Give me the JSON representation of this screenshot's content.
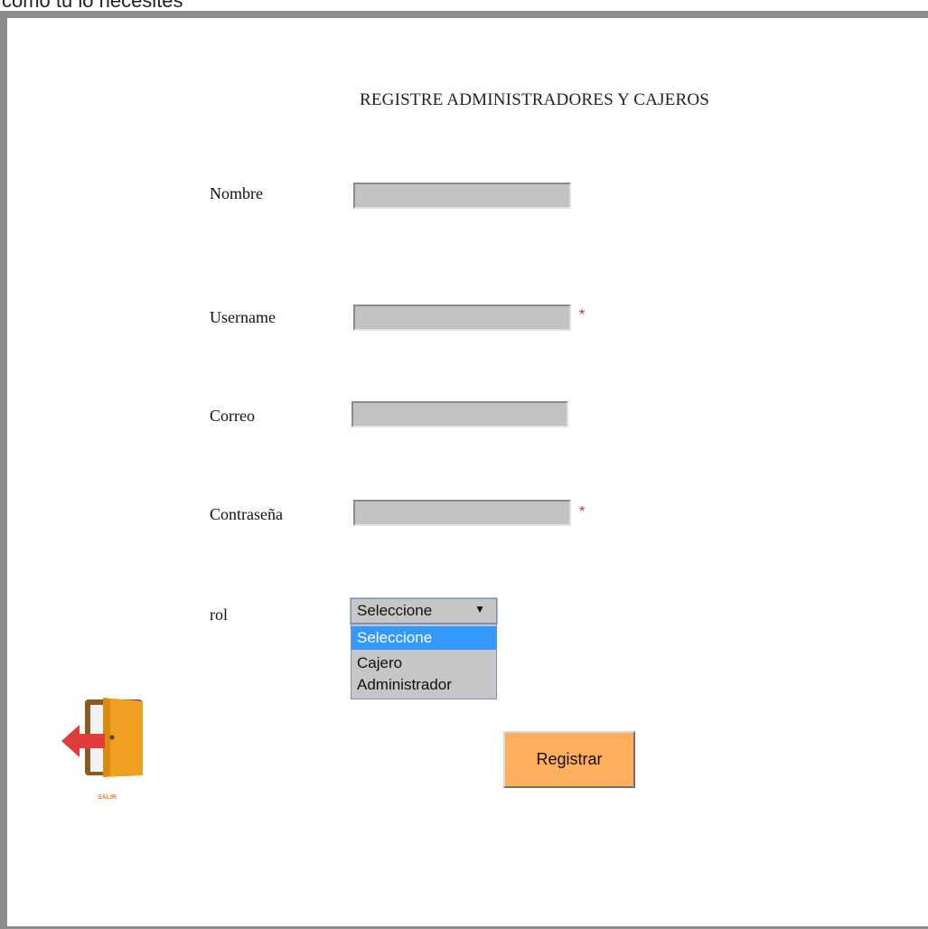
{
  "caption": "como tu lo necesites",
  "form": {
    "title": "REGISTRE ADMINISTRADORES Y CAJEROS",
    "nombre_label": "Nombre",
    "username_label": "Username",
    "correo_label": "Correo",
    "contrasena_label": "Contraseña",
    "rol_label": "rol",
    "required_mark": "*",
    "nombre_value": "",
    "username_value": "",
    "correo_value": "",
    "contrasena_value": ""
  },
  "rol_select": {
    "selected": "Seleccione",
    "arrow": "▼",
    "options": [
      "Seleccione",
      "Cajero",
      "Administrador"
    ],
    "highlighted_index": 0
  },
  "register_button": "Registrar",
  "exit": {
    "label": "SALIR",
    "icon": "exit-door-icon"
  },
  "colors": {
    "field_bg": "#c2c2c2",
    "required": "#e02020",
    "button_bg": "#ffae5c",
    "highlight": "#3399ff",
    "exit_label": "#f07f1a"
  }
}
